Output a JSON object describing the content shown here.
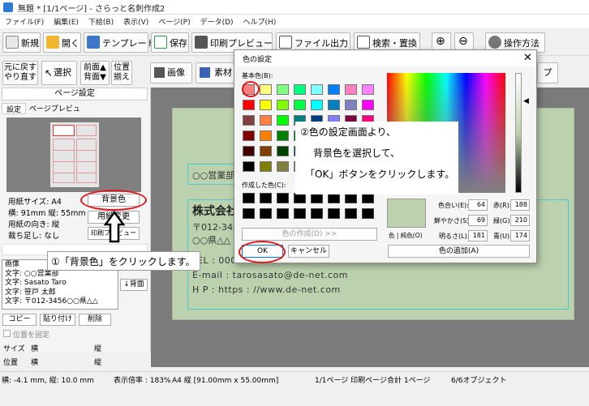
{
  "window": {
    "title": "無題 * [1/1ページ] - さらっと名刺作成2"
  },
  "menu": [
    "ファイル(F)",
    "編集(E)",
    "下絵(B)",
    "表示(V)",
    "ページ(P)",
    "データ(D)",
    "ヘルプ(H)"
  ],
  "toolbar": {
    "new": "新規",
    "open": "開く",
    "template": "テンプレート",
    "save": "保存",
    "print_preview": "印刷プレビュー",
    "file_output": "ファイル出力",
    "search_replace": "検索・置換",
    "howto": "操作方法"
  },
  "toolbar2": {
    "undo": "元に戻す",
    "redo": "やり直す",
    "select": "選択",
    "front": "前面▲",
    "back": "背面▼",
    "position": "位置",
    "align": "揃え",
    "image": "画像",
    "material": "素材",
    "frame_suffix": "プ"
  },
  "left": {
    "header": "ページ設定",
    "tabs": [
      "設定",
      "ページプレビュー"
    ],
    "paper_size": "用紙サイズ: A4",
    "dims": "横: 91mm  縦: 55mm",
    "orientation": "用紙の向き: 縦",
    "bleed": "裁ち足し: なし",
    "bg_button": "背景色",
    "change_button": "用紙変更",
    "print_button": "印刷プレビュー",
    "layers": [
      "画像",
      "文字: ○○営業部",
      "文字: Sasato Taro",
      "文字: 笹戸 太郎",
      "文字: 〒012-3456○○県△△"
    ],
    "back_button": "↓背面",
    "copy": "コピー",
    "paste": "貼り付け",
    "delete": "削除",
    "fix_position": "位置を固定",
    "size_label": "サイズ",
    "pos_label": "位置",
    "h_label": "横",
    "v_label": "縦"
  },
  "card": {
    "dept": "○○営業部",
    "company": "株式会社",
    "zip": "〒012-3456",
    "addr": "○○県△△",
    "tel": "EL : 000-111-2222   FAX : 000-222-3333",
    "email": "E-mail : tarosasato@de-net.com",
    "web": "H P : https : //www.de-net.com"
  },
  "dialog": {
    "title": "色の設定",
    "basic_label": "基本色(B):",
    "custom_label": "作成した色(C):",
    "define_button": "色の作成(D) >>",
    "ok": "OK",
    "cancel": "キャンセル",
    "solid_label": "色 | 純色(O)",
    "add_button": "色の追加(A)",
    "hue_label": "色合い(E):",
    "hue": "64",
    "sat_label": "鮮やかさ(S):",
    "sat": "69",
    "lum_label": "明るさ(L):",
    "lum": "181",
    "red_label": "赤(R):",
    "red": "188",
    "green_label": "緑(G):",
    "green": "210",
    "blue_label": "青(U):",
    "blue": "174",
    "current_color": "#bcd2ae",
    "basic_colors": [
      "#ff8080",
      "#ffff80",
      "#80ff80",
      "#00ff80",
      "#80ffff",
      "#0080ff",
      "#ff80c0",
      "#ff80ff",
      "#ff0000",
      "#ffff00",
      "#80ff00",
      "#00ff40",
      "#00ffff",
      "#0080c0",
      "#8080c0",
      "#ff00ff",
      "#804040",
      "#ff8040",
      "#00ff00",
      "#008080",
      "#004080",
      "#8080ff",
      "#800040",
      "#ff0080",
      "#800000",
      "#ff8000",
      "#008000",
      "#008040",
      "#0000ff",
      "#0000a0",
      "#800080",
      "#8000ff",
      "#400000",
      "#804000",
      "#004000",
      "#004040",
      "#000080",
      "#000040",
      "#400040",
      "#400080",
      "#000000",
      "#808000",
      "#808040",
      "#808080",
      "#408080",
      "#c0c0c0",
      "#400040",
      "#ffffff"
    ]
  },
  "callouts": {
    "step1": "①「背景色」をクリックします。",
    "step2_l1": "②色の設定画面より、",
    "step2_l2": "背景色を選択して、",
    "step2_l3": "「OK」ボタンをクリックします。"
  },
  "status": {
    "coords": "横: -4.1 mm, 縦: 10.0 mm",
    "zoom": "表示倍率 : 183%",
    "paper": "A4 縦 [91.00mm x 55.00mm]",
    "pages": "1/1ページ 印刷ページ合計 1ページ",
    "objects": "6/6オブジェクト"
  }
}
